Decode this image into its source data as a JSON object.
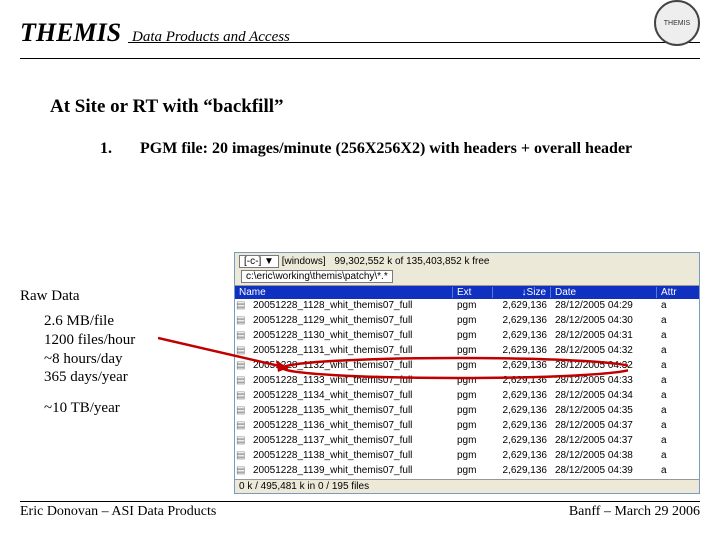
{
  "header": {
    "brand": "THEMIS",
    "subtitle": "Data Products and Access",
    "logo_label": "THEMIS"
  },
  "section_title": "At Site or RT with “backfill”",
  "item": {
    "number": "1.",
    "text": "PGM file: 20 images/minute (256X256X2) with headers + overall header"
  },
  "raw_data": {
    "heading": "Raw Data",
    "lines": [
      "2.6 MB/file",
      "1200 files/hour",
      "~8 hours/day",
      "365 days/year"
    ],
    "lower": "~10 TB/year"
  },
  "fm": {
    "drive": "[-c-]",
    "drive_caret": "▼",
    "drive_type": "[windows]",
    "free": "99,302,552 k of 135,403,852 k free",
    "path": "c:\\eric\\working\\themis\\patchy\\*.*",
    "columns": {
      "name": "Name",
      "ext": "Ext",
      "size": "↓Size",
      "date": "Date",
      "attr": "Attr"
    },
    "rows": [
      {
        "name": "20051228_1128_whit_themis07_full",
        "ext": "pgm",
        "size": "2,629,136",
        "date": "28/12/2005 04:29",
        "attr": "a"
      },
      {
        "name": "20051228_1129_whit_themis07_full",
        "ext": "pgm",
        "size": "2,629,136",
        "date": "28/12/2005 04:30",
        "attr": "a"
      },
      {
        "name": "20051228_1130_whit_themis07_full",
        "ext": "pgm",
        "size": "2,629,136",
        "date": "28/12/2005 04:31",
        "attr": "a"
      },
      {
        "name": "20051228_1131_whit_themis07_full",
        "ext": "pgm",
        "size": "2,629,136",
        "date": "28/12/2005 04:32",
        "attr": "a"
      },
      {
        "name": "20051228_1132_whit_themis07_full",
        "ext": "pgm",
        "size": "2,629,136",
        "date": "28/12/2005 04:32",
        "attr": "a"
      },
      {
        "name": "20051228_1133_whit_themis07_full",
        "ext": "pgm",
        "size": "2,629,136",
        "date": "28/12/2005 04:33",
        "attr": "a"
      },
      {
        "name": "20051228_1134_whit_themis07_full",
        "ext": "pgm",
        "size": "2,629,136",
        "date": "28/12/2005 04:34",
        "attr": "a"
      },
      {
        "name": "20051228_1135_whit_themis07_full",
        "ext": "pgm",
        "size": "2,629,136",
        "date": "28/12/2005 04:35",
        "attr": "a"
      },
      {
        "name": "20051228_1136_whit_themis07_full",
        "ext": "pgm",
        "size": "2,629,136",
        "date": "28/12/2005 04:37",
        "attr": "a"
      },
      {
        "name": "20051228_1137_whit_themis07_full",
        "ext": "pgm",
        "size": "2,629,136",
        "date": "28/12/2005 04:37",
        "attr": "a"
      },
      {
        "name": "20051228_1138_whit_themis07_full",
        "ext": "pgm",
        "size": "2,629,136",
        "date": "28/12/2005 04:38",
        "attr": "a"
      },
      {
        "name": "20051228_1139_whit_themis07_full",
        "ext": "pgm",
        "size": "2,629,136",
        "date": "28/12/2005 04:39",
        "attr": "a"
      }
    ],
    "status": "0 k / 495,481 k in 0 / 195 files"
  },
  "footer": {
    "left": "Eric Donovan – ASI Data Products",
    "right": "Banff – March 29 2006"
  }
}
